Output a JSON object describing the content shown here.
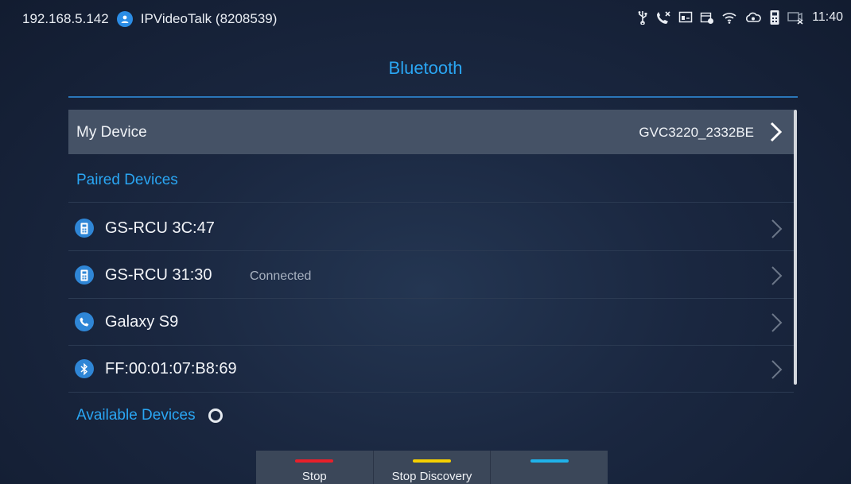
{
  "statusbar": {
    "ip": "192.168.5.142",
    "account": "IPVideoTalk (8208539)",
    "time": "11:40",
    "icons": [
      "usb-icon",
      "missed-call-icon",
      "screen-icon",
      "calendar-icon",
      "wifi-icon",
      "cloud-icon",
      "remote-icon",
      "no-camera-icon"
    ]
  },
  "page": {
    "title": "Bluetooth"
  },
  "my_device": {
    "label": "My Device",
    "value": "GVC3220_2332BE"
  },
  "sections": {
    "paired": "Paired Devices",
    "available": "Available Devices"
  },
  "paired_devices": [
    {
      "name": "GS-RCU 3C:47",
      "status": "",
      "icon": "remote-icon"
    },
    {
      "name": "GS-RCU 31:30",
      "status": "Connected",
      "icon": "remote-icon"
    },
    {
      "name": "Galaxy S9",
      "status": "",
      "icon": "phone-icon"
    },
    {
      "name": "FF:00:01:07:B8:69",
      "status": "",
      "icon": "bluetooth-icon"
    }
  ],
  "bottom_buttons": [
    {
      "label": "Stop",
      "color": "#e8202a"
    },
    {
      "label": "Stop Discovery",
      "color": "#f5d000"
    },
    {
      "label": "",
      "color": "#1fb2ea"
    }
  ],
  "colors": {
    "accent": "#2aa6f3",
    "selected_row": "#455266",
    "icon_bg": "#2f86d6"
  }
}
